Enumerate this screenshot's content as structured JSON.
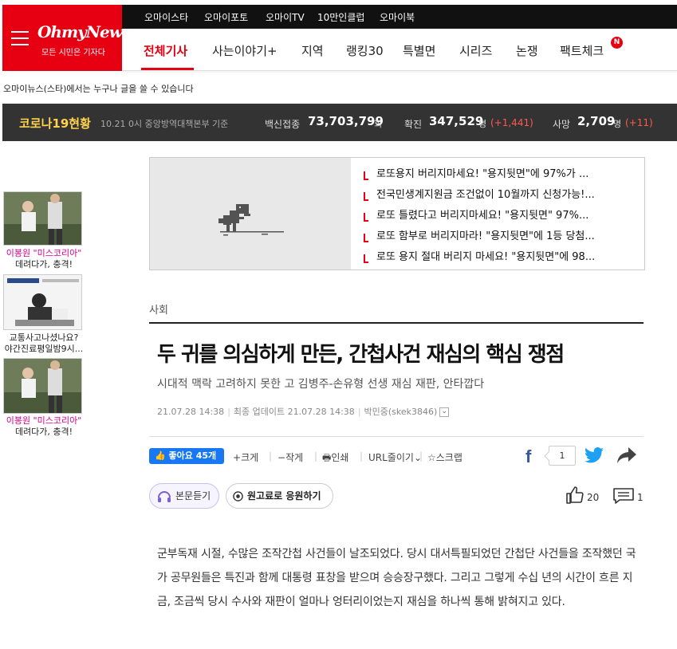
{
  "logo": {
    "name": "OhmyNews",
    "slogan": "모든 시민은 기자다"
  },
  "topbar": [
    "오마이스타",
    "오마이포토",
    "오마이TV",
    "10만인클럽",
    "오마이북"
  ],
  "nav": {
    "items": [
      "전체기사",
      "사는이야기+",
      "지역",
      "랭킹30",
      "특별면",
      "시리즈",
      "논쟁",
      "팩트체크"
    ],
    "badge": "N"
  },
  "notice": "오마이뉴스(스타)에서는 누구나 글을 쓸 수 있습니다",
  "covid": {
    "title": "코로나19현황",
    "date": "10.21 0시 중앙방역대책본부 기준",
    "vaccine_label": "백신접종",
    "vaccine_num": "73,703,799",
    "vaccine_unit": "회",
    "cases_label": "확진",
    "cases_num": "347,529",
    "cases_unit": "명",
    "cases_delta": "(+1,441)",
    "deaths_label": "사망",
    "deaths_num": "2,709",
    "deaths_unit": "명",
    "deaths_delta": "(+11)"
  },
  "side_ads": [
    {
      "caption_a": "이봉원 \"미스코리아\"",
      "caption_b": "데려다가, 충격!"
    },
    {
      "caption_a": "교통사고나셨나요?",
      "caption_b": "야간진료평일밤9시..."
    },
    {
      "caption_a": "이봉원 \"미스코리아\"",
      "caption_b": "데려다가, 충격!"
    }
  ],
  "related": [
    "로또용지 버리지마세요! \"용지뒷면\"에 97%가 ...",
    "전국민생계지원금 조건없이 10월까지 신청가능!...",
    "로또 틀렸다고 버리지마세요! \"용지뒷면\" 97%...",
    "로또 함부로 버리지마라! \"용지뒷면\"에 1등 당첨...",
    "로또 용지 절대 버리지 마세요! \"용지뒷면\"에 98..."
  ],
  "article": {
    "section": "사회",
    "headline": "두 귀를 의심하게 만든, 간첩사건 재심의 핵심 쟁점",
    "subhead": "시대적 맥락 고려하지 못한 고 김병주-손유형 선생 재심 재판, 안타깝다",
    "published": "21.07.28 14:38",
    "updated": "최종 업데이트 21.07.28 14:38",
    "author": "박민중(skek3846)",
    "body": "군부독재 시절, 수많은 조작간첩 사건들이 날조되었다. 당시 대서특필되었던 간첩단 사건들을 조작했던 국가 공무원들은 특진과 함께 대통령 표창을 받으며 승승장구했다. 그리고 그렇게 수십 년의 시간이 흐른 지금, 조금씩 당시 수사와 재판이 얼마나 엉터리이었는지 재심을 하나씩 통해 밝혀지고 있다."
  },
  "toolbar": {
    "like": "좋아요 45개",
    "bigger": "크게",
    "smaller": "작게",
    "print": "인쇄",
    "url": "URL줄이기",
    "scrap": "스크랩",
    "share_count": "1"
  },
  "actions": {
    "listen": "본문듣기",
    "support": "원고료로 응원하기",
    "likes": "20",
    "comments": "1"
  }
}
